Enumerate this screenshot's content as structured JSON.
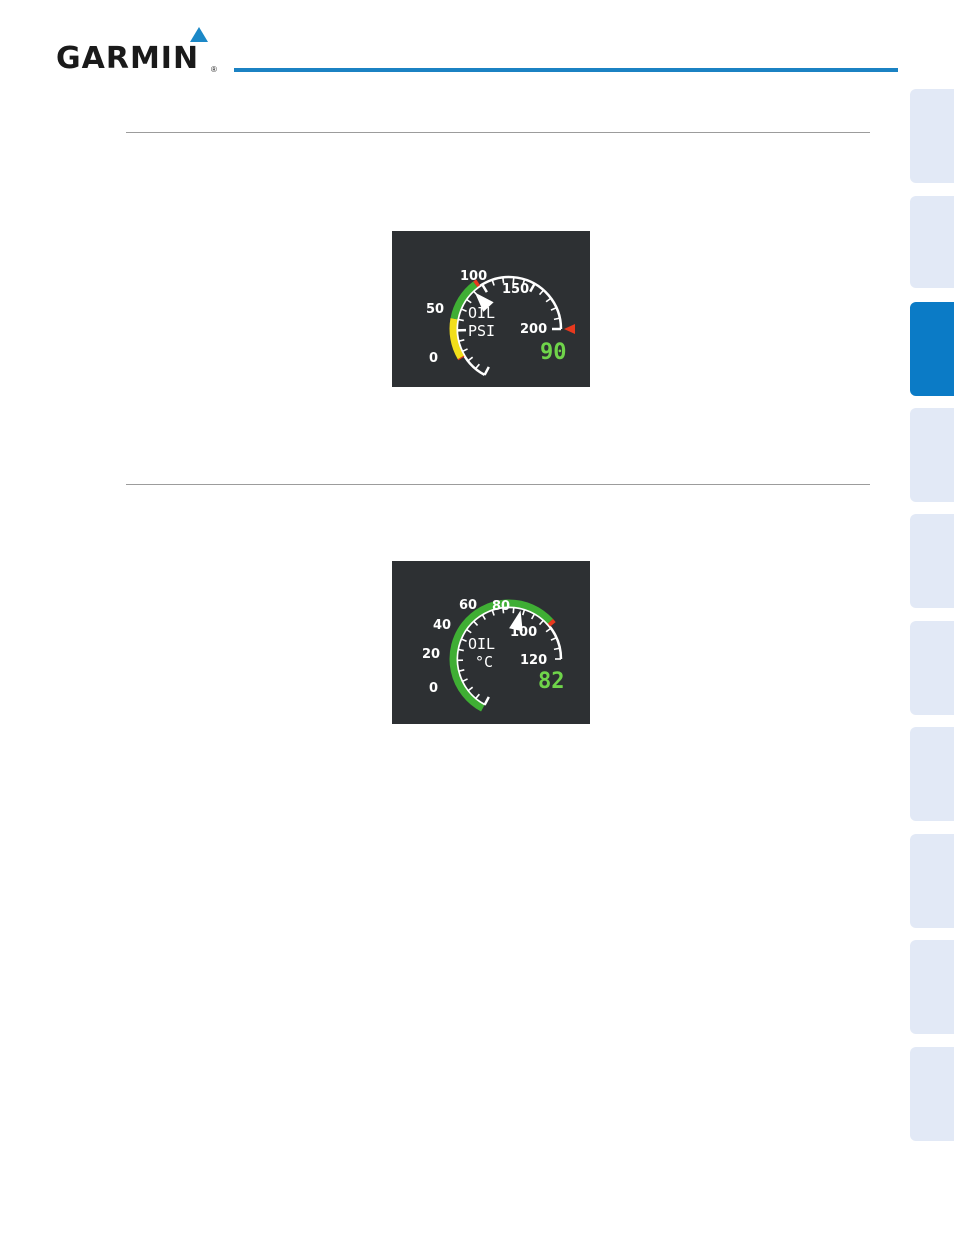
{
  "header": {
    "logo_text": "GARMIN",
    "logo_reg": "®",
    "accent_color": "#1b82c3"
  },
  "side_tabs": {
    "count": 10,
    "active_index": 2,
    "active_color": "#0b7bc6",
    "inactive_color": "#e2e9f6"
  },
  "oil_psi_gauge": {
    "label_line1": "OIL",
    "label_line2": "PSI",
    "readout": "90",
    "value": 90,
    "scale_min": 0,
    "scale_max": 200,
    "tick_labels": [
      "0",
      "50",
      "100",
      "150",
      "200"
    ],
    "bands": [
      {
        "from": 25,
        "to": 26,
        "color": "red"
      },
      {
        "from": 26,
        "to": 60,
        "color": "yellow"
      },
      {
        "from": 60,
        "to": 95,
        "color": "green"
      },
      {
        "from": 95,
        "to": 98,
        "color": "red"
      }
    ],
    "marker": "red triangle at 200"
  },
  "oil_temp_gauge": {
    "label_line1": "OIL",
    "label_line2": "°C",
    "readout": "82",
    "value": 82,
    "scale_min": 0,
    "scale_max": 120,
    "tick_labels": [
      "0",
      "20",
      "40",
      "60",
      "80",
      "100",
      "120"
    ],
    "bands": [
      {
        "from": 0,
        "to": 99,
        "color": "green"
      },
      {
        "from": 99,
        "to": 101,
        "color": "red"
      }
    ]
  }
}
